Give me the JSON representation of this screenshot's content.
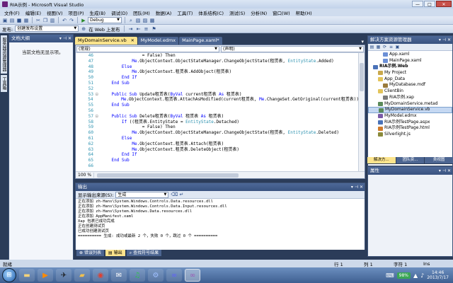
{
  "window": {
    "title": "RIA示例 - Microsoft Visual Studio",
    "minimize": "—",
    "maximize": "□",
    "close": "✕"
  },
  "menus": [
    "文件(F)",
    "编辑(E)",
    "视图(V)",
    "项目(P)",
    "生成(B)",
    "调试(D)",
    "团队(M)",
    "数据(A)",
    "工具(T)",
    "体系结构(C)",
    "测试(S)",
    "分析(N)",
    "窗口(W)",
    "帮助(H)"
  ],
  "toolbar": {
    "config": "Debug"
  },
  "toolbar2": {
    "publish_label": "发布:",
    "publish_value": "创建发布设置",
    "web_label": "在 Web 上发布"
  },
  "left_rail": {
    "tab1": "服务器资源管理器",
    "tab2": "工具箱"
  },
  "doc_outline": {
    "title": "文档大纲",
    "empty": "当前文档无显示项。"
  },
  "tabs": [
    {
      "label": "MyDomainService.vb",
      "active": true
    },
    {
      "label": "MyModel.edmx",
      "active": false
    },
    {
      "label": "MainPage.xaml*",
      "active": false
    }
  ],
  "editor": {
    "nav_left": "(常规)",
    "nav_right": "(声明)",
    "zoom": "100 %",
    "lines": [
      {
        "n": "46",
        "mark": "",
        "code": [
          [
            "plain",
            "                = False) Then"
          ]
        ]
      },
      {
        "n": "47",
        "mark": "",
        "code": [
          [
            "plain",
            "            "
          ],
          [
            "kw",
            "Me"
          ],
          [
            "plain",
            ".ObjectContext.ObjectStateManager.ChangeObjectState(租赁表, "
          ],
          [
            "ty",
            "EntityState"
          ],
          [
            "plain",
            ".Added)"
          ]
        ]
      },
      {
        "n": "48",
        "mark": "",
        "code": [
          [
            "plain",
            "        "
          ],
          [
            "kw",
            "Else"
          ]
        ]
      },
      {
        "n": "49",
        "mark": "",
        "code": [
          [
            "plain",
            "            "
          ],
          [
            "kw",
            "Me"
          ],
          [
            "plain",
            ".ObjectContext.租赁表.AddObject(租赁表)"
          ]
        ]
      },
      {
        "n": "50",
        "mark": "",
        "code": [
          [
            "plain",
            "        "
          ],
          [
            "kw",
            "End If"
          ]
        ]
      },
      {
        "n": "51",
        "mark": "",
        "code": [
          [
            "plain",
            "    "
          ],
          [
            "kw",
            "End Sub"
          ]
        ]
      },
      {
        "n": "52",
        "mark": "",
        "code": [
          [
            "plain",
            ""
          ]
        ]
      },
      {
        "n": "53",
        "mark": "⊟",
        "code": [
          [
            "plain",
            "    "
          ],
          [
            "kw",
            "Public Sub"
          ],
          [
            "plain",
            " Update租赁表("
          ],
          [
            "kw",
            "ByVal"
          ],
          [
            "plain",
            " current租赁表 "
          ],
          [
            "kw",
            "As"
          ],
          [
            "plain",
            " 租赁表)"
          ]
        ]
      },
      {
        "n": "54",
        "mark": "",
        "code": [
          [
            "plain",
            "        "
          ],
          [
            "kw",
            "Me"
          ],
          [
            "plain",
            ".ObjectContext.租赁表.AttachAsModified(current租赁表, "
          ],
          [
            "kw",
            "Me"
          ],
          [
            "plain",
            ".ChangeSet.GetOriginal(current租赁表))"
          ]
        ]
      },
      {
        "n": "55",
        "mark": "",
        "code": [
          [
            "plain",
            "    "
          ],
          [
            "kw",
            "End Sub"
          ]
        ]
      },
      {
        "n": "56",
        "mark": "",
        "code": [
          [
            "plain",
            ""
          ]
        ]
      },
      {
        "n": "57",
        "mark": "⊟",
        "code": [
          [
            "plain",
            "    "
          ],
          [
            "kw",
            "Public Sub"
          ],
          [
            "plain",
            " Delete租赁表("
          ],
          [
            "kw",
            "ByVal"
          ],
          [
            "plain",
            " 租赁表 "
          ],
          [
            "kw",
            "As"
          ],
          [
            "plain",
            " 租赁表)"
          ]
        ]
      },
      {
        "n": "58",
        "mark": "",
        "code": [
          [
            "plain",
            "        "
          ],
          [
            "kw",
            "If"
          ],
          [
            "plain",
            " ((租赁表.EntityState = "
          ],
          [
            "ty",
            "EntityState"
          ],
          [
            "plain",
            ".Detached)"
          ]
        ]
      },
      {
        "n": "59",
        "mark": "",
        "code": [
          [
            "plain",
            "                = False) Then"
          ]
        ]
      },
      {
        "n": "60",
        "mark": "",
        "code": [
          [
            "plain",
            "            "
          ],
          [
            "kw",
            "Me"
          ],
          [
            "plain",
            ".ObjectContext.ObjectStateManager.ChangeObjectState(租赁表, "
          ],
          [
            "ty",
            "EntityState"
          ],
          [
            "plain",
            ".Deleted)"
          ]
        ]
      },
      {
        "n": "61",
        "mark": "",
        "code": [
          [
            "plain",
            "        "
          ],
          [
            "kw",
            "Else"
          ]
        ]
      },
      {
        "n": "62",
        "mark": "",
        "code": [
          [
            "plain",
            "            "
          ],
          [
            "kw",
            "Me"
          ],
          [
            "plain",
            ".ObjectContext.租赁表.Attach(租赁表)"
          ]
        ]
      },
      {
        "n": "63",
        "mark": "",
        "code": [
          [
            "plain",
            "            "
          ],
          [
            "kw",
            "Me"
          ],
          [
            "plain",
            ".ObjectContext.租赁表.DeleteObject(租赁表)"
          ]
        ]
      },
      {
        "n": "64",
        "mark": "",
        "code": [
          [
            "plain",
            "        "
          ],
          [
            "kw",
            "End If"
          ]
        ]
      },
      {
        "n": "65",
        "mark": "",
        "code": [
          [
            "plain",
            "    "
          ],
          [
            "kw",
            "End Sub"
          ]
        ]
      },
      {
        "n": "66",
        "mark": "",
        "code": [
          [
            "plain",
            ""
          ]
        ]
      }
    ]
  },
  "output": {
    "title": "输出",
    "source_label": "显示输出来源(S):",
    "source_value": "生成",
    "lines": [
      "正在添加 zh-Hans\\System.Windows.Controls.Data.resources.dll",
      "正在添加 zh-Hans\\System.Windows.Controls.Data.Input.resources.dll",
      "正在添加 zh-Hans\\System.Windows.Data.resources.dll",
      "正在添加 AppManifest.xaml",
      "Xap 包裹已成功完成",
      "正在创建测试页",
      "已成功创建测试页",
      "========== 生成: 成功或最新 2 个，失败 0 个，跳过 0 个 =========="
    ],
    "tabs": [
      "错误列表",
      "输出",
      "查找符号结果"
    ]
  },
  "solution": {
    "title": "解决方案资源管理器",
    "items": [
      {
        "label": "App.xaml",
        "indent": 3,
        "color": "#6b8fd6",
        "bold": false,
        "sel": false
      },
      {
        "label": "MainPage.xaml",
        "indent": 3,
        "color": "#6b8fd6",
        "bold": false,
        "sel": false
      },
      {
        "label": "RIA示例.Web",
        "indent": 1,
        "color": "#4a72b8",
        "bold": true,
        "sel": false
      },
      {
        "label": "My Project",
        "indent": 2,
        "color": "#c9a84c",
        "bold": false,
        "sel": false
      },
      {
        "label": "App_Data",
        "indent": 2,
        "color": "#e3c45a",
        "bold": false,
        "sel": false
      },
      {
        "label": "MyDatabase.mdf",
        "indent": 3,
        "color": "#9a7b3b",
        "bold": false,
        "sel": false
      },
      {
        "label": "ClientBin",
        "indent": 2,
        "color": "#e3c45a",
        "bold": false,
        "sel": false
      },
      {
        "label": "RIA示例.xap",
        "indent": 3,
        "color": "#7a7a7a",
        "bold": false,
        "sel": false
      },
      {
        "label": "MyDomainService.metad",
        "indent": 2,
        "color": "#5a8a5a",
        "bold": false,
        "sel": false
      },
      {
        "label": "MyDomainService.vb",
        "indent": 2,
        "color": "#5a8a5a",
        "bold": false,
        "sel": true
      },
      {
        "label": "MyModel.edmx",
        "indent": 2,
        "color": "#7a5aa8",
        "bold": false,
        "sel": false
      },
      {
        "label": "RIA示例TestPage.aspx",
        "indent": 2,
        "color": "#4a72b8",
        "bold": false,
        "sel": false
      },
      {
        "label": "RIA示例TestPage.html",
        "indent": 2,
        "color": "#d07a2a",
        "bold": false,
        "sel": false
      },
      {
        "label": "Silverlight.js",
        "indent": 2,
        "color": "#8a8a3a",
        "bold": false,
        "sel": false
      }
    ],
    "tabs": [
      "解决方...",
      "团队资...",
      "类视图"
    ]
  },
  "properties": {
    "title": "属性"
  },
  "status": {
    "ready": "就绪",
    "row": "行 1",
    "col": "列 1",
    "char": "字符 1",
    "ins": "Ins"
  },
  "taskbar": {
    "battery": "98%",
    "time": "14:46",
    "date": "2013/7/17"
  }
}
